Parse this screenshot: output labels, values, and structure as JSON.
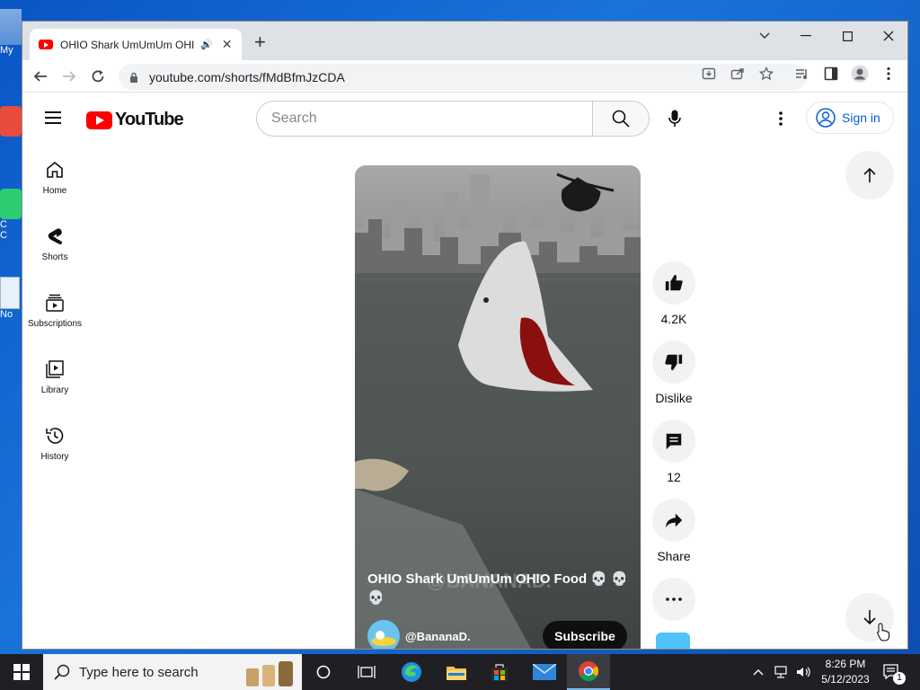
{
  "desktop": {
    "icons": [
      {
        "label": "My"
      },
      {
        "label": "C"
      },
      {
        "label": "C"
      },
      {
        "label": "No"
      }
    ]
  },
  "browser": {
    "tab_title": "OHIO Shark UmUmUm OHIO",
    "url": "youtube.com/shorts/fMdBfmJzCDA"
  },
  "youtube": {
    "logo_text": "YouTube",
    "search_placeholder": "Search",
    "signin_label": "Sign in",
    "guide": [
      {
        "label": "Home"
      },
      {
        "label": "Shorts"
      },
      {
        "label": "Subscriptions"
      },
      {
        "label": "Library"
      },
      {
        "label": "History"
      }
    ],
    "short": {
      "title": "OHIO Shark UmUmUm OHIO Food 💀 💀 💀",
      "channel": "@BananaD.",
      "subscribe_label": "Subscribe",
      "watermark": "@BANANAD."
    },
    "actions": {
      "likes": "4.2K",
      "dislike_label": "Dislike",
      "comments": "12",
      "share_label": "Share"
    }
  },
  "taskbar": {
    "search_placeholder": "Type here to search",
    "time": "8:26 PM",
    "date": "5/12/2023",
    "notification_count": "1"
  },
  "colors": {
    "youtube_red": "#ff0000",
    "link_blue": "#065fd4",
    "taskbar_bg": "#1f1f24"
  }
}
